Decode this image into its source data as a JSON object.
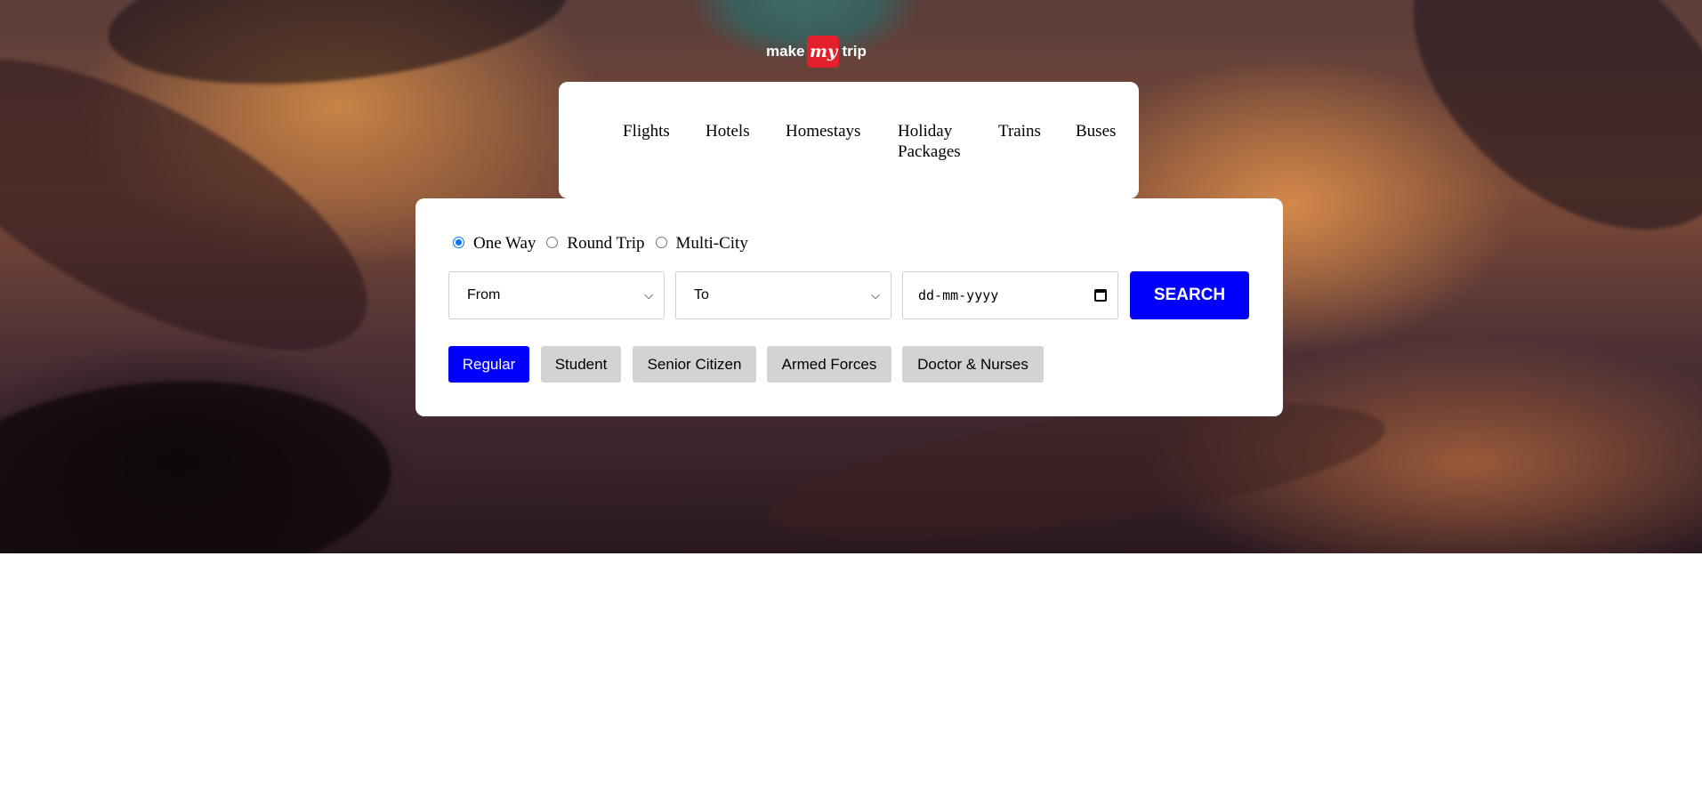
{
  "logo": {
    "left": "make",
    "mid": "my",
    "right": "trip"
  },
  "nav": {
    "items": [
      {
        "label": "Flights"
      },
      {
        "label": "Hotels"
      },
      {
        "label": "Homestays"
      },
      {
        "label": "Holiday\nPackages"
      },
      {
        "label": "Trains"
      },
      {
        "label": "Buses"
      }
    ]
  },
  "trip_types": [
    {
      "label": "One Way",
      "checked": true
    },
    {
      "label": "Round Trip",
      "checked": false
    },
    {
      "label": "Multi-City",
      "checked": false
    }
  ],
  "search": {
    "from_value": "From",
    "to_value": "To",
    "date_placeholder": "dd-mm-yyyy",
    "button_label": "SEARCH"
  },
  "fares": [
    {
      "label": "Regular",
      "active": true
    },
    {
      "label": "Student",
      "active": false
    },
    {
      "label": "Senior Citizen",
      "active": false
    },
    {
      "label": "Armed Forces",
      "active": false
    },
    {
      "label": "Doctor & Nurses",
      "active": false
    }
  ],
  "colors": {
    "accent": "#0000ff",
    "logo_red": "#e5202c",
    "inactive_button": "#d3d3d3"
  },
  "icons": [
    "chevron-down-icon",
    "calendar-icon"
  ]
}
